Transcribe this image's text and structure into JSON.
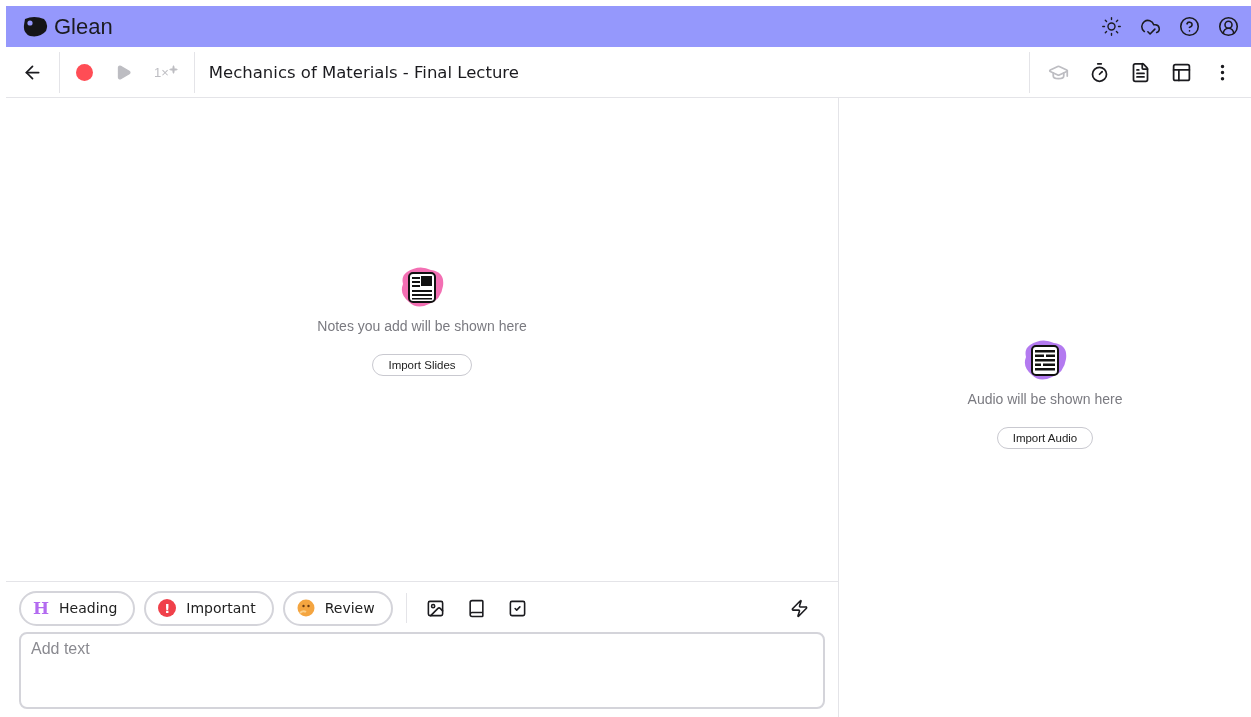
{
  "app": {
    "name": "Glean"
  },
  "toolbar": {
    "title": "Mechanics of Materials - Final Lecture",
    "recording": true,
    "play_disabled": true,
    "speed": "1×",
    "speed_disabled": true,
    "study_disabled": true
  },
  "notes_panel": {
    "message": "Notes you add will be shown here",
    "button": "Import Slides"
  },
  "audio_panel": {
    "message": "Audio will be shown here",
    "button": "Import Audio"
  },
  "tags": [
    {
      "kind": "heading",
      "glyph": "H",
      "label": "Heading"
    },
    {
      "kind": "important",
      "glyph": "!",
      "label": "Important"
    },
    {
      "kind": "review",
      "label": "Review"
    }
  ],
  "editor": {
    "placeholder": "Add text"
  }
}
